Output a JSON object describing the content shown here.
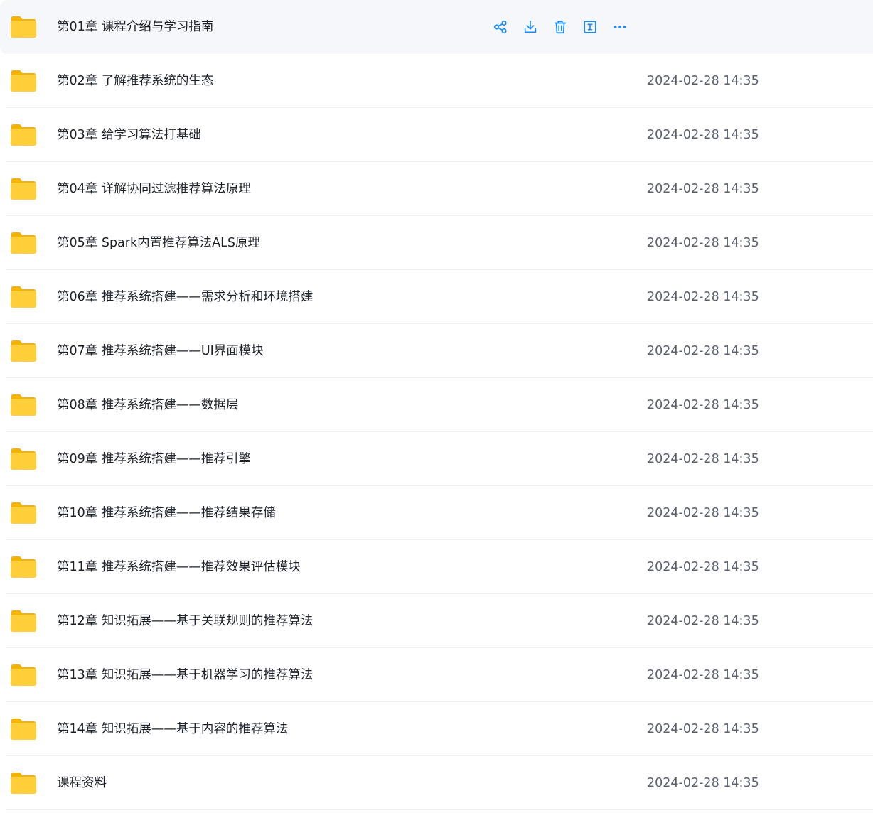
{
  "colors": {
    "accent": "#1a8cff",
    "folder_front": "#ffce38",
    "folder_back": "#f5b300",
    "hover_row": "#f6f7fa",
    "text": "#1d2129",
    "time_text": "#5b6170"
  },
  "hovered_actions": [
    {
      "name": "share-icon"
    },
    {
      "name": "download-icon"
    },
    {
      "name": "delete-icon"
    },
    {
      "name": "rename-icon"
    },
    {
      "name": "more-icon"
    }
  ],
  "files": [
    {
      "name": "第01章 课程介绍与学习指南",
      "time": "",
      "hovered": true
    },
    {
      "name": "第02章 了解推荐系统的生态",
      "time": "2024-02-28 14:35"
    },
    {
      "name": "第03章 给学习算法打基础",
      "time": "2024-02-28 14:35"
    },
    {
      "name": "第04章 详解协同过滤推荐算法原理",
      "time": "2024-02-28 14:35"
    },
    {
      "name": "第05章 Spark内置推荐算法ALS原理",
      "time": "2024-02-28 14:35"
    },
    {
      "name": "第06章 推荐系统搭建——需求分析和环境搭建",
      "time": "2024-02-28 14:35"
    },
    {
      "name": "第07章 推荐系统搭建——UI界面模块",
      "time": "2024-02-28 14:35"
    },
    {
      "name": "第08章 推荐系统搭建——数据层",
      "time": "2024-02-28 14:35"
    },
    {
      "name": "第09章 推荐系统搭建——推荐引擎",
      "time": "2024-02-28 14:35"
    },
    {
      "name": "第10章 推荐系统搭建——推荐结果存储",
      "time": "2024-02-28 14:35"
    },
    {
      "name": "第11章 推荐系统搭建——推荐效果评估模块",
      "time": "2024-02-28 14:35"
    },
    {
      "name": "第12章 知识拓展——基于关联规则的推荐算法",
      "time": "2024-02-28 14:35"
    },
    {
      "name": "第13章 知识拓展——基于机器学习的推荐算法",
      "time": "2024-02-28 14:35"
    },
    {
      "name": "第14章 知识拓展——基于内容的推荐算法",
      "time": "2024-02-28 14:35"
    },
    {
      "name": "课程资料",
      "time": "2024-02-28 14:35"
    }
  ]
}
